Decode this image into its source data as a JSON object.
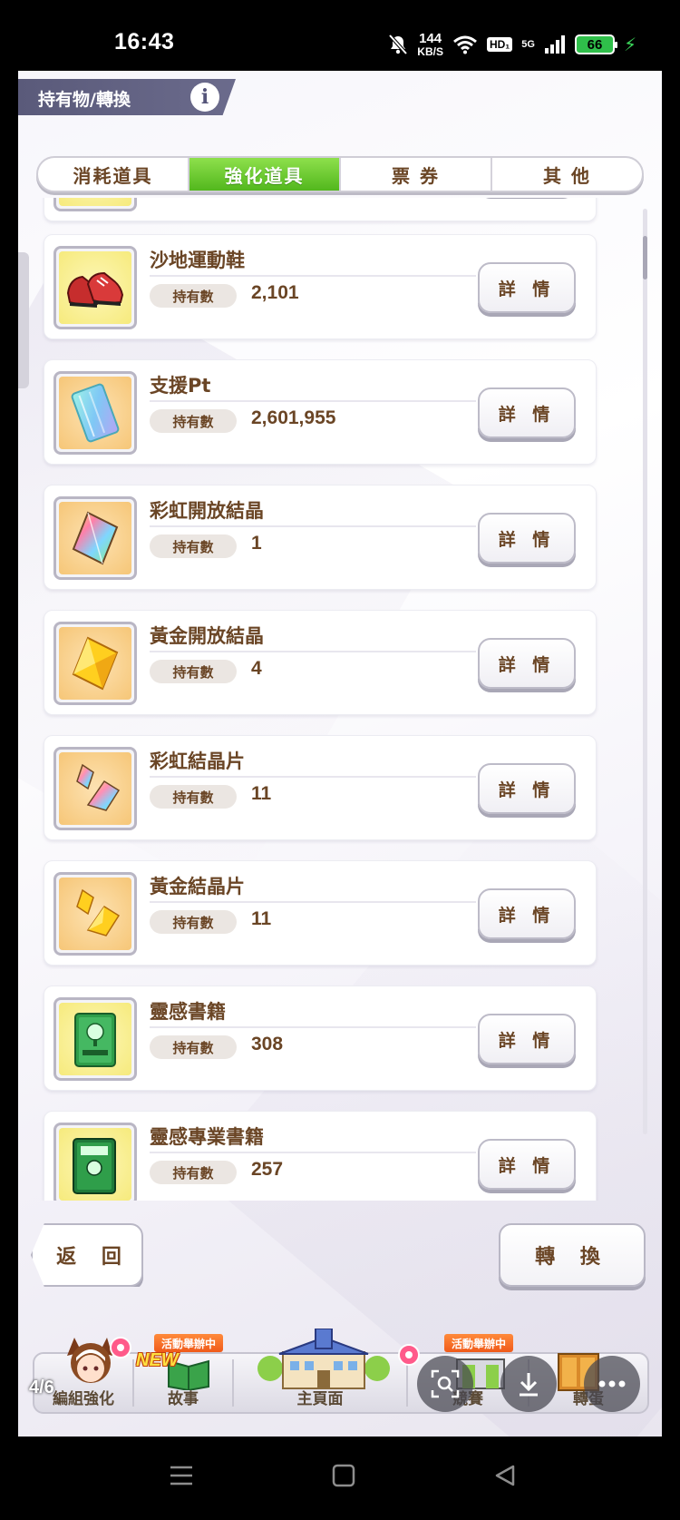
{
  "status_bar": {
    "time": "16:43",
    "net_speed_value": "144",
    "net_speed_unit": "KB/S",
    "hd_label": "HD₁",
    "network": "5G",
    "battery": "66"
  },
  "header": {
    "title": "持有物/轉換",
    "info_icon": "i"
  },
  "tabs": [
    {
      "label": "消耗道具",
      "active": false
    },
    {
      "label": "強化道具",
      "active": true
    },
    {
      "label": "票 券",
      "active": false
    },
    {
      "label": "其 他",
      "active": false
    }
  ],
  "owned_label": "持有數",
  "detail_label": "詳 情",
  "items": [
    {
      "name": "沙地運動鞋",
      "count": "2,101",
      "icon": "running-shoes-icon"
    },
    {
      "name": "支援Pt",
      "count": "2,601,955",
      "icon": "support-pt-card-icon"
    },
    {
      "name": "彩虹開放結晶",
      "count": "1",
      "icon": "rainbow-crystal-icon"
    },
    {
      "name": "黃金開放結晶",
      "count": "4",
      "icon": "gold-crystal-icon"
    },
    {
      "name": "彩虹結晶片",
      "count": "11",
      "icon": "rainbow-shard-icon"
    },
    {
      "name": "黃金結晶片",
      "count": "11",
      "icon": "gold-shard-icon"
    },
    {
      "name": "靈感書籍",
      "count": "308",
      "icon": "green-book-icon"
    },
    {
      "name": "靈感專業書籍",
      "count": "257",
      "icon": "pro-book-icon"
    }
  ],
  "buttons": {
    "back": "返 回",
    "convert": "轉 換"
  },
  "bottom_nav": {
    "items": [
      "編組強化",
      "故事",
      "主頁面",
      "競賽",
      "轉蛋"
    ],
    "event_tag": "活動舉辦中",
    "new_tag": "NEW",
    "page_indicator": "4/6"
  },
  "colors": {
    "accent_green": "#52b71d",
    "text_brown": "#6a4525",
    "title_bar": "#5a5a7a"
  }
}
